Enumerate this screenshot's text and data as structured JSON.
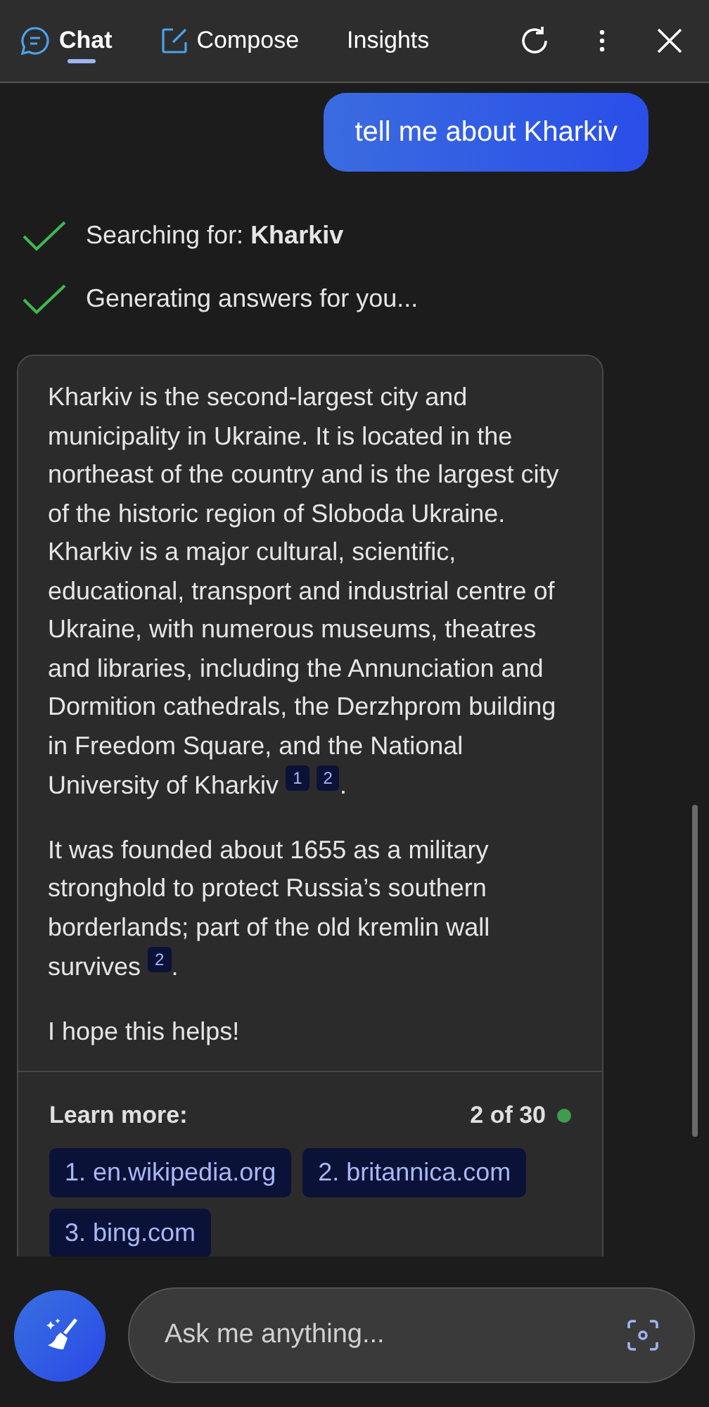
{
  "tabs": [
    {
      "label": "Chat",
      "kind": "chat",
      "selected": true
    },
    {
      "label": "Compose",
      "kind": "compose",
      "selected": false
    },
    {
      "label": "Insights",
      "kind": "none",
      "selected": false
    }
  ],
  "user_message": "tell me about Kharkiv",
  "status_lines": [
    {
      "text": "Searching for: **Kharkiv**",
      "done": true
    },
    {
      "text": "Generating answers for you...",
      "done": true
    }
  ],
  "answer": {
    "paragraphs": [
      {
        "text": "Kharkiv is the second-largest city and municipality in Ukraine. It is located in the northeast of the country and is the largest city of the historic region of Sloboda Ukraine. Kharkiv is a major cultural, scientific, educational, transport and industrial centre of Ukraine, with numerous museums, theatres and libraries, including the Annunciation and Dormition cathedrals, the Derzhprom building in Freedom Square, and the National University of Kharkiv",
        "citations": [
          "1",
          "2"
        ],
        "end": "."
      },
      {
        "text": "It was founded about 1655 as a military stronghold to protect Russia’s southern borderlands; part of the old kremlin wall survives",
        "citations": [
          "2"
        ],
        "end": "."
      },
      {
        "text": "I hope this helps!"
      }
    ],
    "learn_more": {
      "label": "Learn more:",
      "count": "2 of 30",
      "links": [
        "1. en.wikipedia.org",
        "2. britannica.com",
        "3. bing.com"
      ]
    }
  },
  "input": {
    "placeholder": "Ask me anything..."
  }
}
